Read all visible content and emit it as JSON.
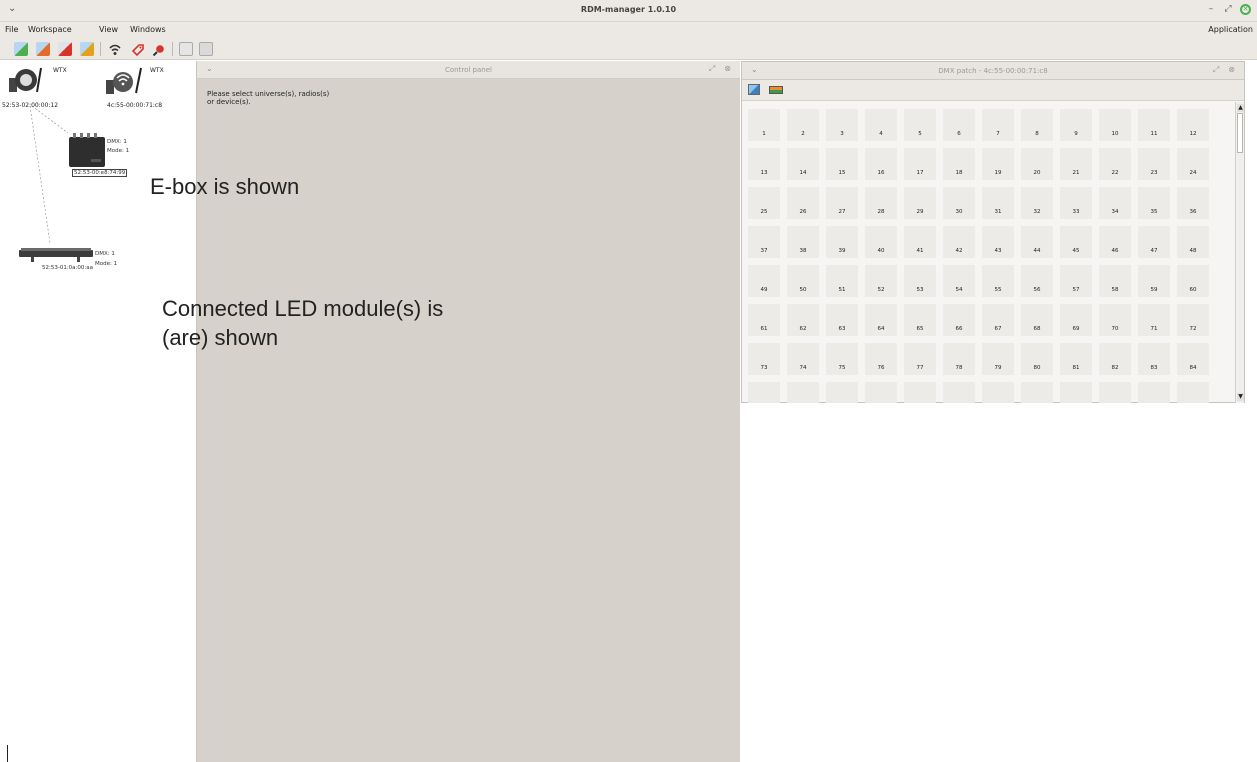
{
  "window": {
    "title": "RDM-manager 1.0.10",
    "menu_chevron": "⌄",
    "controls": {
      "minimize": "–",
      "restore": "⤢",
      "close": "✕"
    }
  },
  "menubar": {
    "items": [
      {
        "label": "File",
        "mnemonic": "F"
      },
      {
        "label": "Workspace",
        "mnemonic": "s"
      },
      {
        "label": "View",
        "mnemonic": "V"
      },
      {
        "label": "Windows",
        "mnemonic": "W"
      }
    ],
    "application": "Application"
  },
  "toolbar": {
    "icons": [
      "import-icon",
      "export-icon",
      "remove-icon",
      "disable-icon",
      "wireless-icon",
      "tag-icon",
      "search-icon",
      "grid-icon",
      "lamp-icon"
    ]
  },
  "tree": {
    "devices": [
      {
        "badge": "WTX",
        "address": "52:53-02:00:00:12"
      },
      {
        "badge": "WTX",
        "address": "4c:55-00:00:71:c8"
      }
    ],
    "ebox": {
      "dmx": "DMX: 1",
      "mode": "Mode: 1",
      "address": "52:53-00:e8:74:99"
    },
    "led_module": {
      "dmx": "DMX: 1",
      "mode": "Mode: 1",
      "address": "52:53-01:0a:00:aa"
    }
  },
  "control_panel": {
    "title": "Control panel",
    "message_line1": "Please select universe(s), radios(s)",
    "message_line2": "or device(s)."
  },
  "dmx_patch": {
    "title": "DMX patch - 4c:55-00:00:71:c8",
    "channels": [
      1,
      2,
      3,
      4,
      5,
      6,
      7,
      8,
      9,
      10,
      11,
      12,
      13,
      14,
      15,
      16,
      17,
      18,
      19,
      20,
      21,
      22,
      23,
      24,
      25,
      26,
      27,
      28,
      29,
      30,
      31,
      32,
      33,
      34,
      35,
      36,
      37,
      38,
      39,
      40,
      41,
      42,
      43,
      44,
      45,
      46,
      47,
      48,
      49,
      50,
      51,
      52,
      53,
      54,
      55,
      56,
      57,
      58,
      59,
      60,
      61,
      62,
      63,
      64,
      65,
      66,
      67,
      68,
      69,
      70,
      71,
      72,
      73,
      74,
      75,
      76,
      77,
      78,
      79,
      80,
      81,
      82,
      83,
      84
    ]
  },
  "annotations": {
    "ebox": "E-box is shown",
    "led_line1": "Connected LED module(s) is",
    "led_line2": "(are) shown"
  }
}
